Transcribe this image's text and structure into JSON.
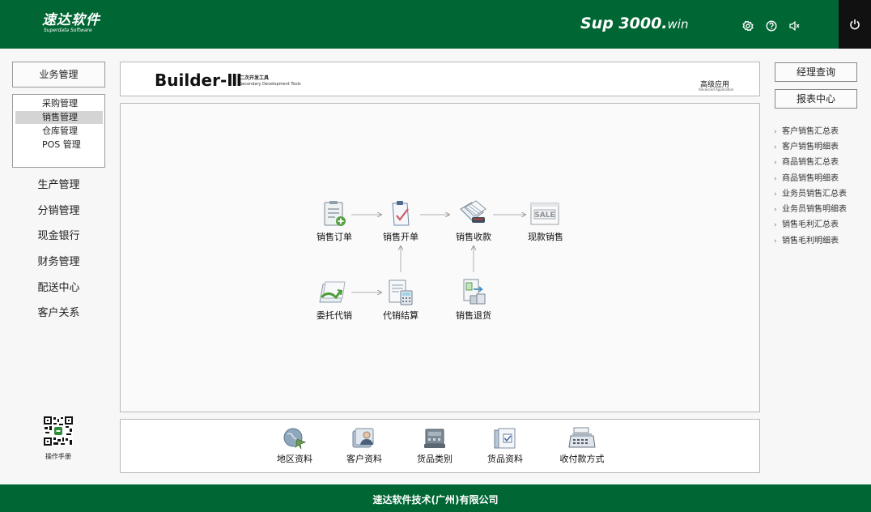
{
  "header": {
    "logo_cn": "速达软件",
    "logo_en": "Superdata Software",
    "app_title_main": "Sup 3000.",
    "app_title_suffix": "win",
    "icons": [
      "settings-icon",
      "help-icon",
      "sound-icon",
      "power-icon"
    ]
  },
  "sidebar": {
    "top_button": "业务管理",
    "sub_items": [
      {
        "label": "采购管理",
        "selected": false
      },
      {
        "label": "销售管理",
        "selected": true
      },
      {
        "label": "仓库管理",
        "selected": false
      },
      {
        "label": "POS 管理",
        "selected": false
      }
    ],
    "nav_items": [
      "生产管理",
      "分销管理",
      "现金银行",
      "财务管理",
      "配送中心",
      "客户关系"
    ],
    "qr_label": "操作手册"
  },
  "builder": {
    "word": "Builder-Ⅲ",
    "sub_cn": "二次开发工具",
    "sub_en": "Secondary Development Tools",
    "adv_cn": "高级应用",
    "adv_en": "Advanced Application"
  },
  "flow": {
    "nodes": [
      {
        "label": "销售订单",
        "icon": "sales-order-icon"
      },
      {
        "label": "销售开单",
        "icon": "sales-invoice-icon"
      },
      {
        "label": "销售收款",
        "icon": "sales-receipt-icon"
      },
      {
        "label": "现款销售",
        "icon": "cash-sale-icon"
      },
      {
        "label": "委托代销",
        "icon": "consignment-icon"
      },
      {
        "label": "代销结算",
        "icon": "consignment-settlement-icon"
      },
      {
        "label": "销售退货",
        "icon": "sales-return-icon"
      }
    ]
  },
  "bottom": {
    "items": [
      {
        "label": "地区资料",
        "icon": "region-data-icon"
      },
      {
        "label": "客户资料",
        "icon": "customer-data-icon"
      },
      {
        "label": "货品类别",
        "icon": "goods-category-icon"
      },
      {
        "label": "货品资料",
        "icon": "goods-data-icon"
      },
      {
        "label": "收付款方式",
        "icon": "payment-method-icon"
      }
    ]
  },
  "right": {
    "buttons": [
      "经理查询",
      "报表中心"
    ],
    "links": [
      "客户销售汇总表",
      "客户销售明细表",
      "商品销售汇总表",
      "商品销售明细表",
      "业务员销售汇总表",
      "业务员销售明细表",
      "销售毛利汇总表",
      "销售毛利明细表"
    ]
  },
  "footer": {
    "company": "速达软件技术(广州)有限公司"
  },
  "colors": {
    "brand_green": "#006633",
    "power_bg": "#111111"
  }
}
